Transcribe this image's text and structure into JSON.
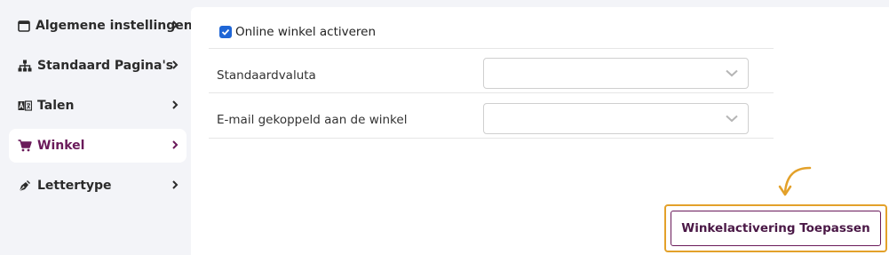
{
  "sidebar": {
    "items": [
      {
        "label": "Algemene instellingen",
        "icon": "window-icon",
        "active": false
      },
      {
        "label": "Standaard Pagina's",
        "icon": "sitemap-icon",
        "active": false
      },
      {
        "label": "Talen",
        "icon": "language-icon",
        "active": false
      },
      {
        "label": "Winkel",
        "icon": "cart-icon",
        "active": true
      },
      {
        "label": "Lettertype",
        "icon": "pen-nib-icon",
        "active": false
      }
    ]
  },
  "settings": {
    "online_shop_checkbox": {
      "label": "Online winkel activeren",
      "checked": true
    },
    "currency": {
      "label": "Standaardvaluta",
      "value": ""
    },
    "email": {
      "label": "E-mail gekoppeld aan de winkel",
      "value": ""
    }
  },
  "actions": {
    "apply_label": "Winkelactivering Toepassen"
  },
  "colors": {
    "accent": "#6a1a5a",
    "highlight": "#e3a12a",
    "checkbox": "#1f66d6",
    "background": "#f3f4f8"
  }
}
